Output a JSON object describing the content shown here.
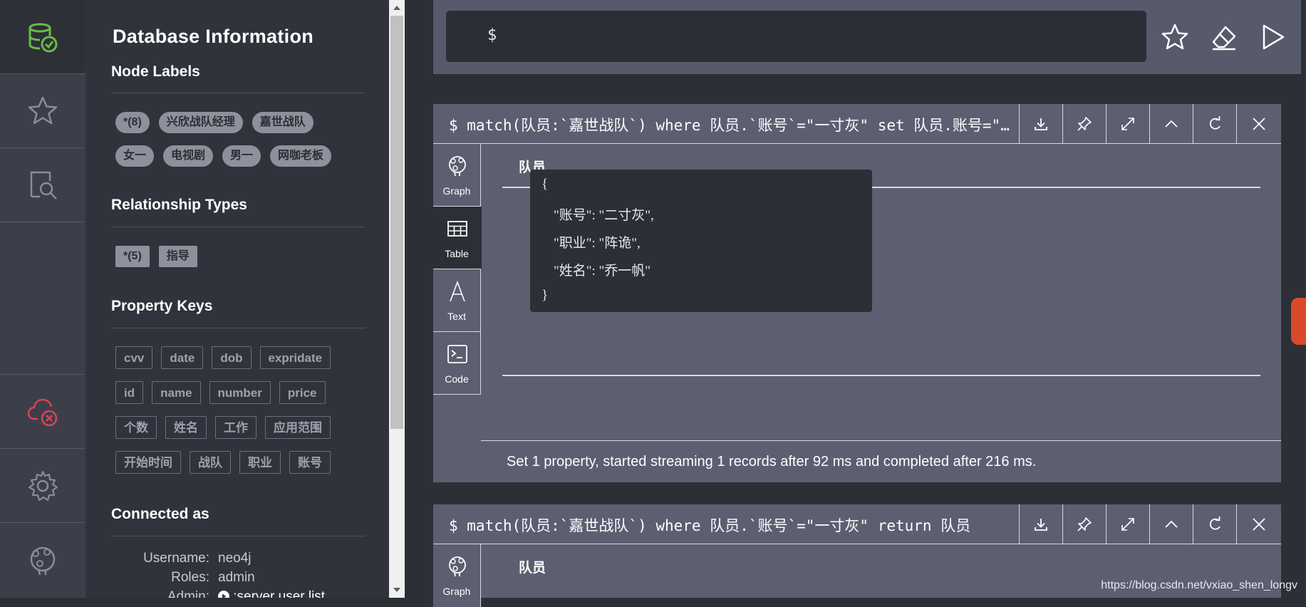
{
  "drawer": {
    "title": "Database Information",
    "node_labels": {
      "title": "Node Labels",
      "items": [
        "*(8)",
        "兴欣战队经理",
        "嘉世战队",
        "女一",
        "电视剧",
        "男一",
        "网咖老板"
      ]
    },
    "relationship_types": {
      "title": "Relationship Types",
      "items": [
        "*(5)",
        "指导"
      ]
    },
    "property_keys": {
      "title": "Property Keys",
      "items": [
        "cvv",
        "date",
        "dob",
        "expridate",
        "id",
        "name",
        "number",
        "price",
        "个数",
        "姓名",
        "工作",
        "应用范围",
        "开始时间",
        "战队",
        "职业",
        "账号"
      ]
    },
    "connected_as": {
      "title": "Connected as",
      "username_label": "Username:",
      "username": "neo4j",
      "roles_label": "Roles:",
      "roles": "admin",
      "admin_label": "Admin:",
      "admin_cmd": ":server user list"
    }
  },
  "editor": {
    "prompt": "$"
  },
  "frames": [
    {
      "query": "$ match(队员:`嘉世战队`) where 队员.`账号`=\"一寸灰\" set 队员.账号=\"二寸灰\" return 队员",
      "tabs": [
        "Graph",
        "Table",
        "Text",
        "Code"
      ],
      "active_tab": "Table",
      "column": "队员",
      "json_lines": [
        "{",
        "\"账号\": \"二寸灰\",",
        "\"职业\": \"阵诡\",",
        "\"姓名\": \"乔一帆\"",
        "}"
      ],
      "status": "Set 1 property, started streaming 1 records after 92 ms and completed after 216 ms."
    },
    {
      "query": "$ match(队员:`嘉世战队`) where 队员.`账号`=\"一寸灰\" return 队员",
      "tabs": [
        "Graph"
      ],
      "column": "队员"
    }
  ],
  "watermark": "https://blog.csdn.net/vxiao_shen_longv",
  "colors": {
    "accent_green": "#68bd45",
    "error_red": "#da4453",
    "bg_dark": "#2d2f37",
    "frame_bg": "#5b5f70"
  }
}
